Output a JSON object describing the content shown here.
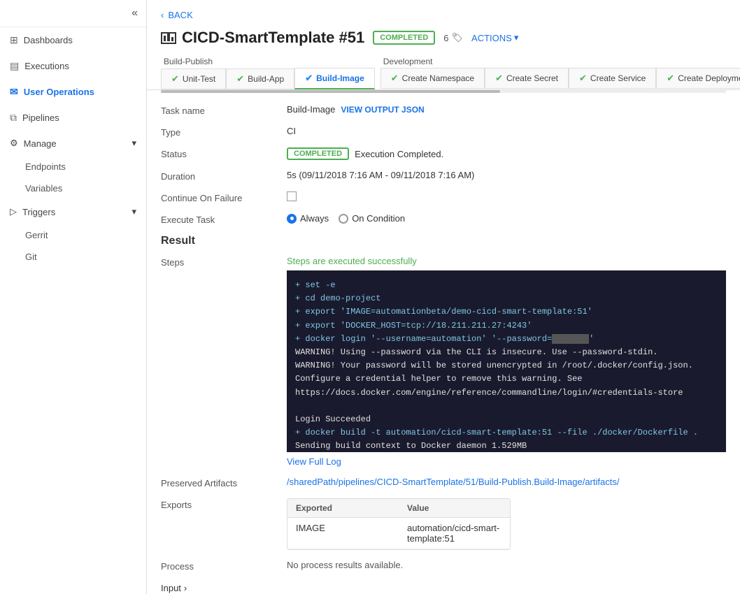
{
  "sidebar": {
    "toggle_icon": "«",
    "items": [
      {
        "id": "dashboards",
        "label": "Dashboards",
        "icon": "⊞",
        "active": false
      },
      {
        "id": "executions",
        "label": "Executions",
        "icon": "▤",
        "active": false
      },
      {
        "id": "user-operations",
        "label": "User Operations",
        "icon": "✉",
        "active": true
      },
      {
        "id": "pipelines",
        "label": "Pipelines",
        "icon": "⧉",
        "active": false
      }
    ],
    "manage": {
      "label": "Manage",
      "icon": "⚙",
      "children": [
        {
          "id": "endpoints",
          "label": "Endpoints"
        },
        {
          "id": "variables",
          "label": "Variables"
        }
      ]
    },
    "triggers": {
      "label": "Triggers",
      "icon": "▷",
      "children": [
        {
          "id": "gerrit",
          "label": "Gerrit"
        },
        {
          "id": "git",
          "label": "Git"
        }
      ]
    }
  },
  "back": {
    "label": "BACK",
    "chevron": "‹"
  },
  "page": {
    "title": "CICD-SmartTemplate #51",
    "status": "COMPLETED",
    "tag_count": "6",
    "tag_icon": "🏷",
    "actions_label": "ACTIONS",
    "actions_chevron": "▾"
  },
  "pipeline": {
    "groups": [
      {
        "label": "Build-Publish",
        "tabs": [
          {
            "id": "unit-test",
            "label": "Unit-Test",
            "check": "✔",
            "active": false
          },
          {
            "id": "build-app",
            "label": "Build-App",
            "check": "✔",
            "active": false
          },
          {
            "id": "build-image",
            "label": "Build-Image",
            "check": "✔",
            "active": true
          }
        ]
      },
      {
        "label": "Development",
        "tabs": [
          {
            "id": "create-namespace",
            "label": "Create Namespace",
            "check": "✔",
            "active": false
          },
          {
            "id": "create-secret",
            "label": "Create Secret",
            "check": "✔",
            "active": false
          },
          {
            "id": "create-service",
            "label": "Create Service",
            "check": "✔",
            "active": false
          },
          {
            "id": "create-deployment",
            "label": "Create Deployment",
            "check": "✔",
            "active": false
          }
        ]
      }
    ]
  },
  "detail": {
    "task_name_label": "Task name",
    "task_name_value": "Build-Image",
    "view_output_label": "VIEW OUTPUT JSON",
    "type_label": "Type",
    "type_value": "CI",
    "status_label": "Status",
    "status_value": "COMPLETED",
    "status_text": "Execution Completed.",
    "duration_label": "Duration",
    "duration_value": "5s (09/11/2018 7:16 AM - 09/11/2018 7:16 AM)",
    "continue_label": "Continue On Failure",
    "execute_label": "Execute Task",
    "execute_always": "Always",
    "execute_condition": "On Condition"
  },
  "result": {
    "section_title": "Result",
    "steps_label": "Steps",
    "steps_success": "Steps are executed successfully",
    "terminal_lines": [
      "+ set -e",
      "+ cd demo-project",
      "+ export 'IMAGE=automationbeta/demo-cicd-smart-template:51'",
      "+ export 'DOCKER_HOST=tcp://18.211.211.27:4243'",
      "+ docker login '--username=automation' '--password=****'",
      "WARNING! Using --password via the CLI is insecure. Use --password-stdin.",
      "WARNING! Your password will be stored unencrypted in /root/.docker/config.json.",
      "Configure a credential helper to remove this warning. See",
      "https://docs.docker.com/engine/reference/commandline/login/#credentials-store",
      "",
      "Login Succeeded",
      "+ docker build -t automation/cicd-smart-template:51 --file ./docker/Dockerfile .",
      "Sending build context to Docker daemon 1.529MB"
    ],
    "view_full_log": "View Full Log"
  },
  "artifacts": {
    "label": "Preserved Artifacts",
    "path": "/sharedPath/pipelines/CICD-SmartTemplate/51/Build-Publish.Build-Image/artifacts/"
  },
  "exports": {
    "label": "Exports",
    "columns": [
      "Exported",
      "Value"
    ],
    "rows": [
      {
        "exported": "IMAGE",
        "value": "automation/cicd-smart-template:51"
      }
    ]
  },
  "process": {
    "label": "Process",
    "value": "No process results available."
  },
  "input": {
    "label": "Input",
    "chevron": "›"
  }
}
